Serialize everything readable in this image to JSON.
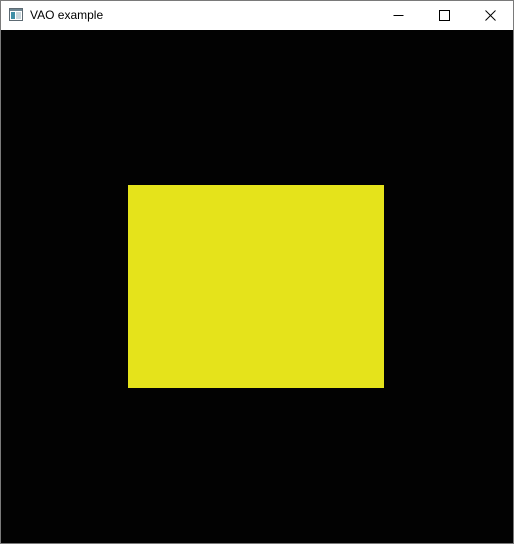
{
  "window": {
    "title": "VAO example",
    "app_icon": "application-window-icon",
    "controls": [
      {
        "name": "minimize",
        "icon": "minimize-icon"
      },
      {
        "name": "maximize",
        "icon": "maximize-icon"
      },
      {
        "name": "close",
        "icon": "close-icon"
      }
    ]
  },
  "render": {
    "clear_color": "#020202",
    "quad_color": "#e5e31b"
  }
}
